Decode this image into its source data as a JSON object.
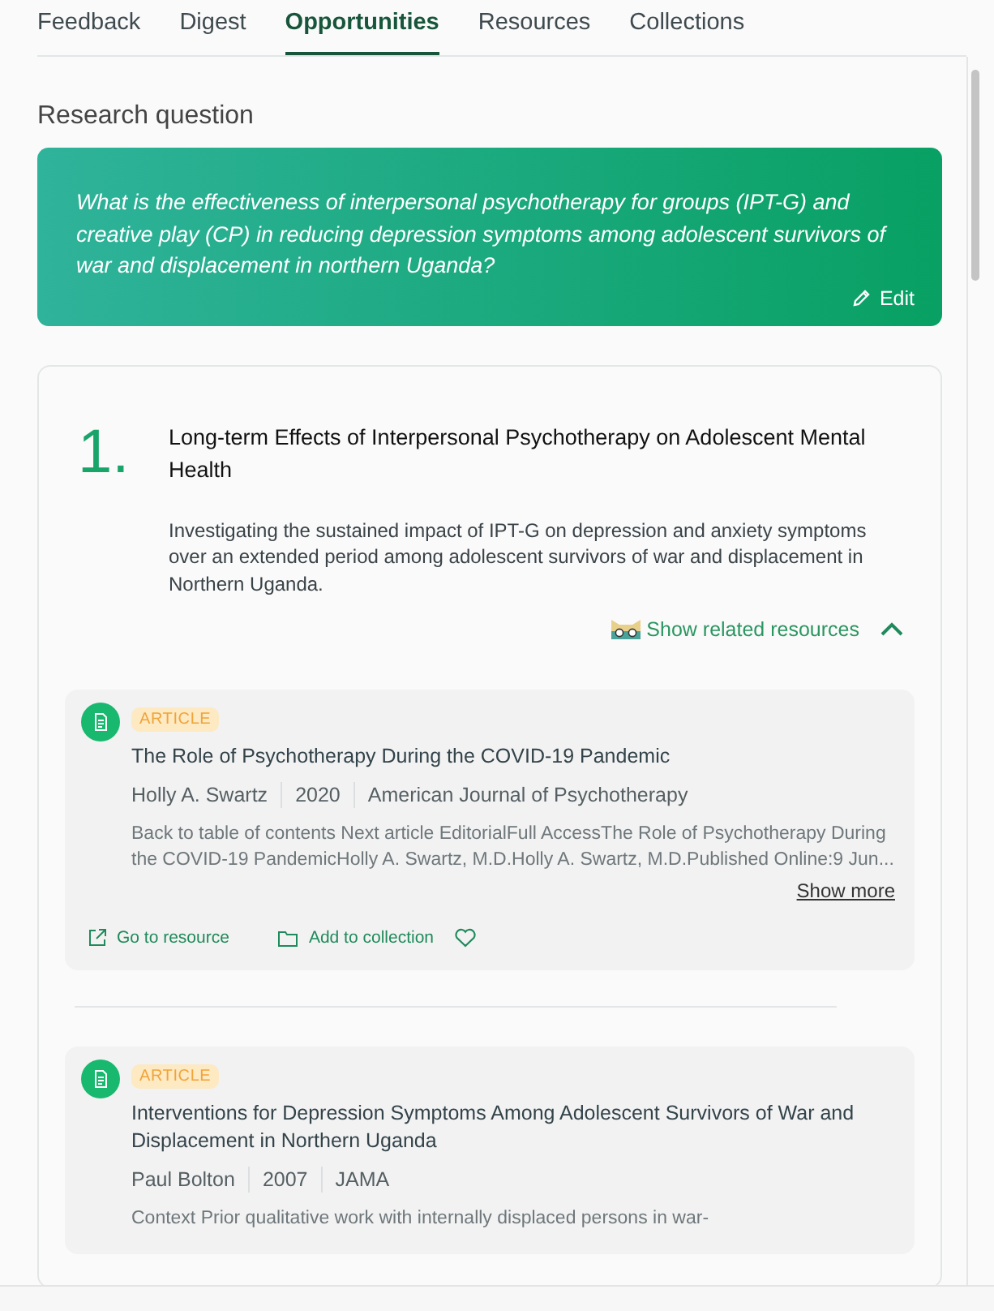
{
  "tabs": [
    {
      "label": "Feedback",
      "selected": false
    },
    {
      "label": "Digest",
      "selected": false
    },
    {
      "label": "Opportunities",
      "selected": true
    },
    {
      "label": "Resources",
      "selected": false
    },
    {
      "label": "Collections",
      "selected": false
    }
  ],
  "research_question": {
    "heading": "Research question",
    "text": "What is the effectiveness of interpersonal psychotherapy for groups (IPT-G) and creative play (CP) in reducing depression symptoms among adolescent survivors of war and displacement in northern Uganda?",
    "edit_label": "Edit"
  },
  "opportunities": [
    {
      "number": "1.",
      "title": "Long-term Effects of Interpersonal Psychotherapy on Adolescent Mental Health",
      "description": "Investigating the sustained impact of IPT-G on depression and anxiety symptoms over an extended period among adolescent survivors of war and displacement in Northern Uganda.",
      "related_label": "Show related resources",
      "expanded": true,
      "resources": [
        {
          "kind": "article",
          "badge": "ARTICLE",
          "title": "The Role of Psychotherapy During the COVID-19 Pandemic",
          "author": "Holly A. Swartz",
          "year": "2020",
          "journal": "American Journal of Psychotherapy",
          "abstract": "Back to table of contents Next article EditorialFull AccessThe Role of Psychotherapy During the COVID-19 PandemicHolly A. Swartz, M.D.Holly A. Swartz, M.D.Published Online:9 Jun...",
          "show_more": "Show more",
          "actions": {
            "go": "Go to resource",
            "collect": "Add to collection"
          }
        },
        {
          "kind": "article",
          "badge": "ARTICLE",
          "title": "Interventions for Depression Symptoms Among Adolescent Survivors of War and Displacement in Northern Uganda",
          "author": "Paul Bolton",
          "year": "2007",
          "journal": "JAMA",
          "abstract": "Context Prior qualitative work with internally displaced persons in war-"
        }
      ]
    }
  ]
}
